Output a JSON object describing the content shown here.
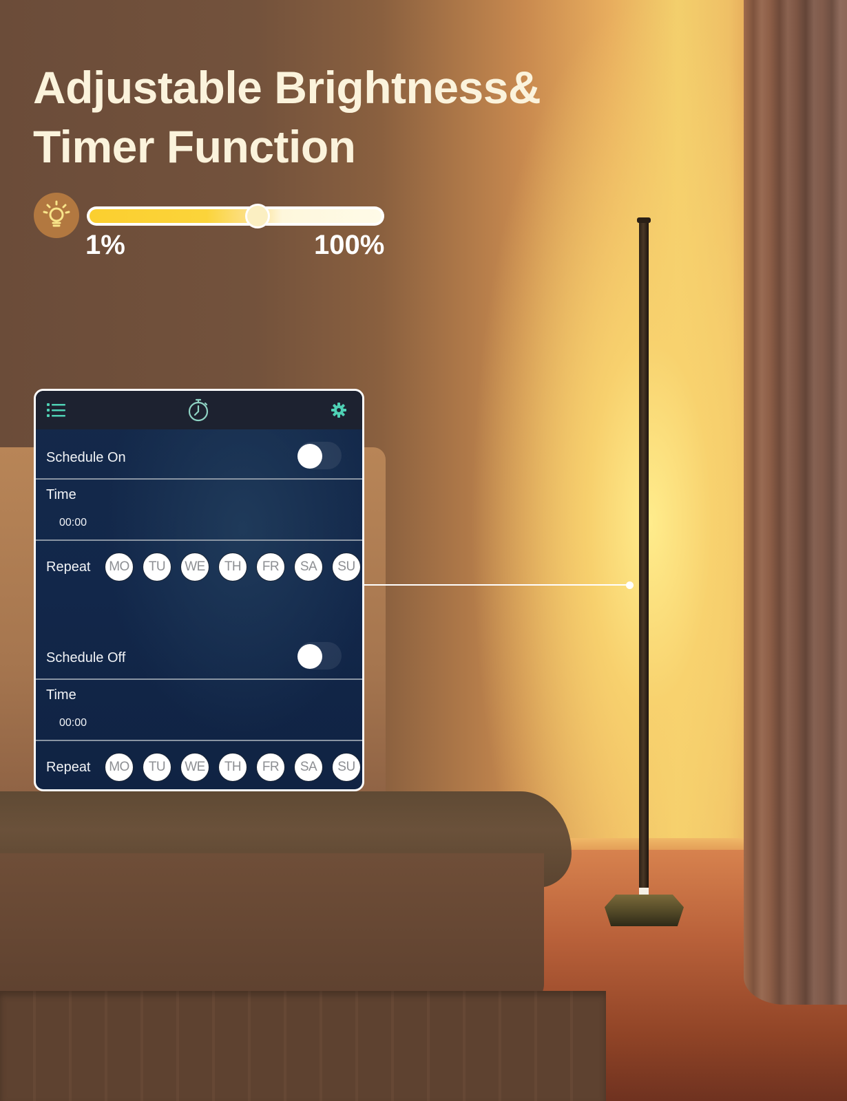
{
  "heading": {
    "line1": "Adjustable Brightness&",
    "line2": "Timer Function"
  },
  "brightness": {
    "icon": "lightbulb-icon",
    "min_label": "1%",
    "max_label": "100%",
    "value_fraction": 0.58,
    "colors": {
      "fill": "#fbcf2f",
      "track": "#fffbe8",
      "icon_bg": "#b27840"
    }
  },
  "app": {
    "topbar": {
      "left_icon": "list-menu-icon",
      "center_icon": "stopwatch-timer-icon",
      "right_icon": "gear-icon",
      "accent": "#4fd1b5"
    },
    "schedule_on": {
      "label": "Schedule On",
      "enabled": false,
      "time_label": "Time",
      "time_value": "00:00",
      "repeat_label": "Repeat",
      "days": [
        "MO",
        "TU",
        "WE",
        "TH",
        "FR",
        "SA",
        "SU"
      ]
    },
    "schedule_off": {
      "label": "Schedule Off",
      "enabled": false,
      "time_label": "Time",
      "time_value": "00:00",
      "repeat_label": "Repeat",
      "days": [
        "MO",
        "TU",
        "WE",
        "TH",
        "FR",
        "SA",
        "SU"
      ]
    }
  }
}
